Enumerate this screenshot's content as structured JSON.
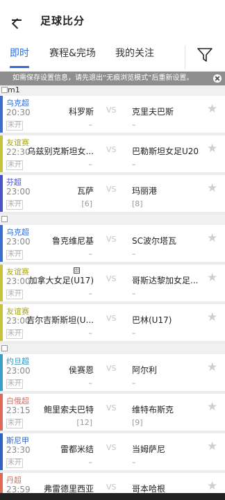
{
  "header": {
    "title": "足球比分"
  },
  "tabs": [
    {
      "label": "即时"
    },
    {
      "label": "赛程&完场"
    },
    {
      "label": "我的关注"
    }
  ],
  "notice": {
    "text": "如需保存设置信息，请先退出“无痕浏览模式”后重新设置。"
  },
  "ads": [
    {
      "label": "m1"
    },
    {
      "label": ""
    },
    {
      "label": ""
    }
  ],
  "matches": [
    {
      "league": "乌克超",
      "league_color": "#3a6fd0",
      "time": "20:30",
      "status": "未开",
      "home": "科罗斯",
      "vs": "VS",
      "away": "克里夫巴斯",
      "home_sub": "–",
      "away_sub": "–"
    },
    {
      "league": "友谊赛",
      "league_color": "#c6c23a",
      "time": "22:30",
      "status": "未开",
      "home": "乌兹别克斯坦女...",
      "vs": "VS",
      "away": "巴勒斯坦女足U20",
      "home_sub": "–",
      "away_sub": "–"
    },
    {
      "league": "芬超",
      "league_color": "#4a52c8",
      "time": "23:00",
      "status": "未开",
      "home": "瓦萨",
      "vs": "VS",
      "away": "玛丽港",
      "home_sub": "[6]",
      "away_sub": "[8]"
    },
    {
      "league": "乌克超",
      "league_color": "#3a6fd0",
      "time": "23:00",
      "status": "未开",
      "home": "鲁克维尼基",
      "vs": "VS",
      "away": "SC波尔塔瓦",
      "home_sub": "–",
      "away_sub": "–"
    },
    {
      "league": "友谊赛",
      "league_color": "#c6c23a",
      "time": "23:00",
      "status": "未开",
      "home": "加拿大女足(U17)",
      "vs": "VS",
      "away": "哥斯达黎加女足...",
      "home_sub": "–",
      "away_sub": "–",
      "tv": "田"
    },
    {
      "league": "友谊赛",
      "league_color": "#c6c23a",
      "time": "23:00",
      "status": "未开",
      "home": "吉尔吉斯斯坦(U...",
      "vs": "VS",
      "away": "巴林(U17)",
      "home_sub": "–",
      "away_sub": "–"
    },
    {
      "league": "约旦超",
      "league_color": "#3aa0c8",
      "time": "23:00",
      "status": "未开",
      "home": "侯赛恩",
      "vs": "VS",
      "away": "阿尔利",
      "home_sub": "–",
      "away_sub": "–"
    },
    {
      "league": "白俄超",
      "league_color": "#e06a5a",
      "time": "23:15",
      "status": "未开",
      "home": "鲍里索夫巴特",
      "vs": "VS",
      "away": "维特布斯克",
      "home_sub": "[12]",
      "away_sub": "[9]"
    },
    {
      "league": "斯尼甲",
      "league_color": "#2f63c4",
      "time": "23:30",
      "status": "未开",
      "home": "雷都米结",
      "vs": "VS",
      "away": "当姆萨尼",
      "home_sub": "–",
      "away_sub": "–"
    },
    {
      "league": "丹超",
      "league_color": "#e06a5a",
      "time": "23:59",
      "status": "未开",
      "home": "弗雷德里西亚",
      "vs": "VS",
      "away": "哥本哈根",
      "home_sub": "",
      "away_sub": ""
    }
  ]
}
